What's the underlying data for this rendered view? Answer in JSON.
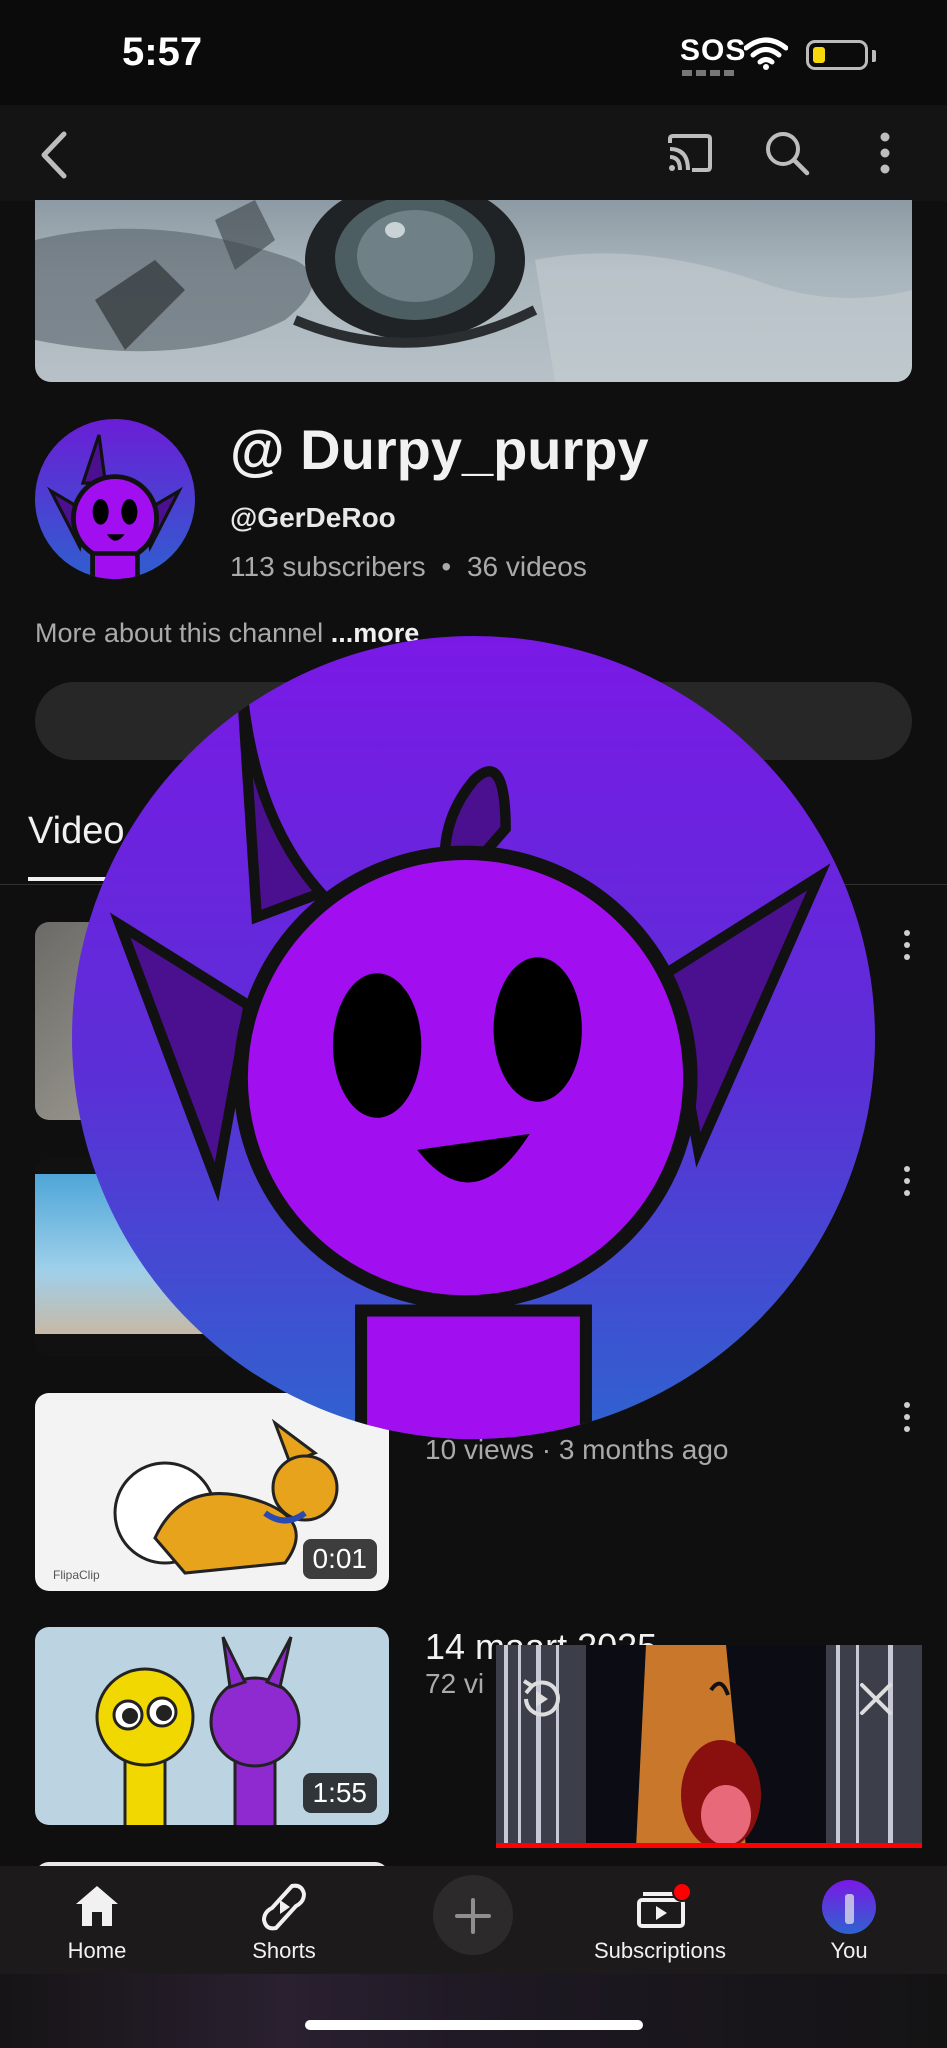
{
  "status_bar": {
    "time": "5:57",
    "sos": "SOS"
  },
  "header": {
    "back_icon": "chevron-left-icon",
    "cast_icon": "cast-icon",
    "search_icon": "search-icon",
    "more_icon": "more-vertical-icon"
  },
  "channel": {
    "name": "@ Durpy_purpy",
    "handle": "@GerDeRoo",
    "subscribers": "113 subscribers",
    "separator": "•",
    "videos": "36 videos",
    "about_text": "More about this channel",
    "about_more": "...more"
  },
  "tabs": {
    "active": "Videos",
    "visible_text": "Video"
  },
  "videos": [
    {
      "meta": ""
    },
    {
      "meta": ""
    },
    {
      "meta": "10 views · 3 months ago",
      "duration": "0:01",
      "watermark": "FlipaClip"
    },
    {
      "title": "14 maart 2025",
      "meta": "72 vi",
      "duration": "1:55"
    }
  ],
  "miniplayer": {
    "replay_icon": "replay-icon",
    "close_icon": "close-icon",
    "progress": 1.0
  },
  "bottom_nav": {
    "items": [
      {
        "label": "Home",
        "icon": "home-icon"
      },
      {
        "label": "Shorts",
        "icon": "shorts-icon"
      },
      {
        "label": "",
        "icon": "plus-icon"
      },
      {
        "label": "Subscriptions",
        "icon": "subscriptions-icon"
      },
      {
        "label": "You",
        "icon": "avatar"
      }
    ]
  },
  "colors": {
    "background": "#0f0f0f",
    "accent_red": "#ff0000",
    "avatar_purple": "#a10ff0"
  }
}
